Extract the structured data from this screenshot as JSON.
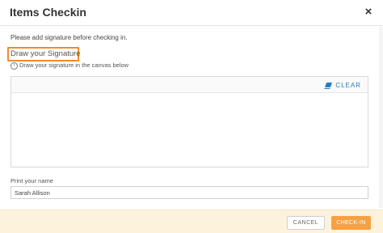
{
  "dialog": {
    "title": "Items Checkin",
    "close_glyph": "×"
  },
  "body": {
    "instruction": "Please add signature before checking in.",
    "section_label": "Draw your Signature",
    "hint": "Draw your signature in the canvas below",
    "hint_icon_glyph": "i",
    "clear_label": "CLEAR"
  },
  "name_field": {
    "label": "Print your name",
    "value": "Sarah Allison"
  },
  "footer": {
    "cancel_label": "CANCEL",
    "checkin_label": "CHECK-IN"
  },
  "icons": {
    "close": "close-icon",
    "info": "info-icon",
    "eraser": "eraser-icon"
  },
  "colors": {
    "accent": "#f5a144",
    "highlight_border": "#f08c2c",
    "link_blue": "#2b7bbf",
    "footer_bg": "#fdf3dc"
  }
}
